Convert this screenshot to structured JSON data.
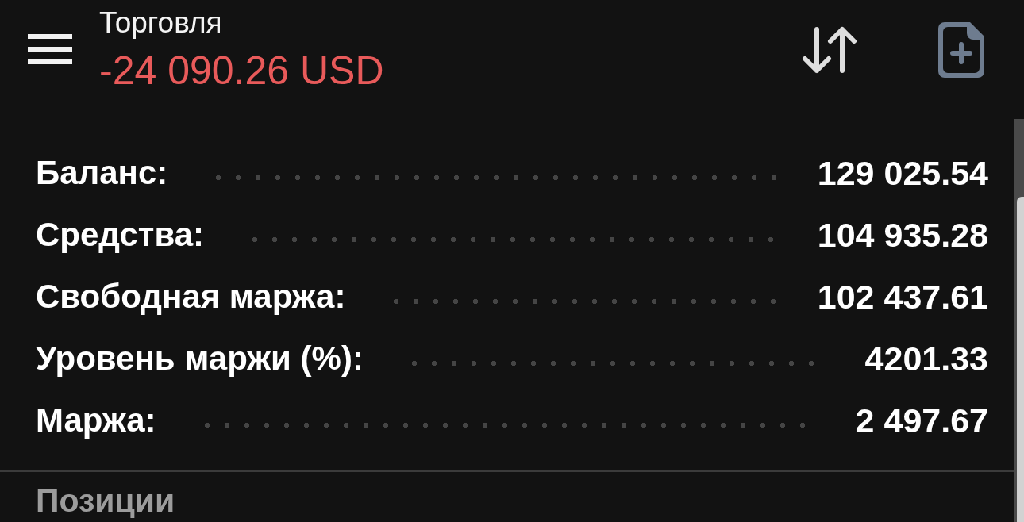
{
  "header": {
    "title": "Торговля",
    "profit": "-24 090.26 USD"
  },
  "account_rows": [
    {
      "label": "Баланс:",
      "value": "129 025.54"
    },
    {
      "label": "Средства:",
      "value": "104 935.28"
    },
    {
      "label": "Свободная маржа:",
      "value": "102 437.61"
    },
    {
      "label": "Уровень маржи (%):",
      "value": "4201.33"
    },
    {
      "label": "Маржа:",
      "value": "2 497.67"
    }
  ],
  "section_title": "Позиции"
}
